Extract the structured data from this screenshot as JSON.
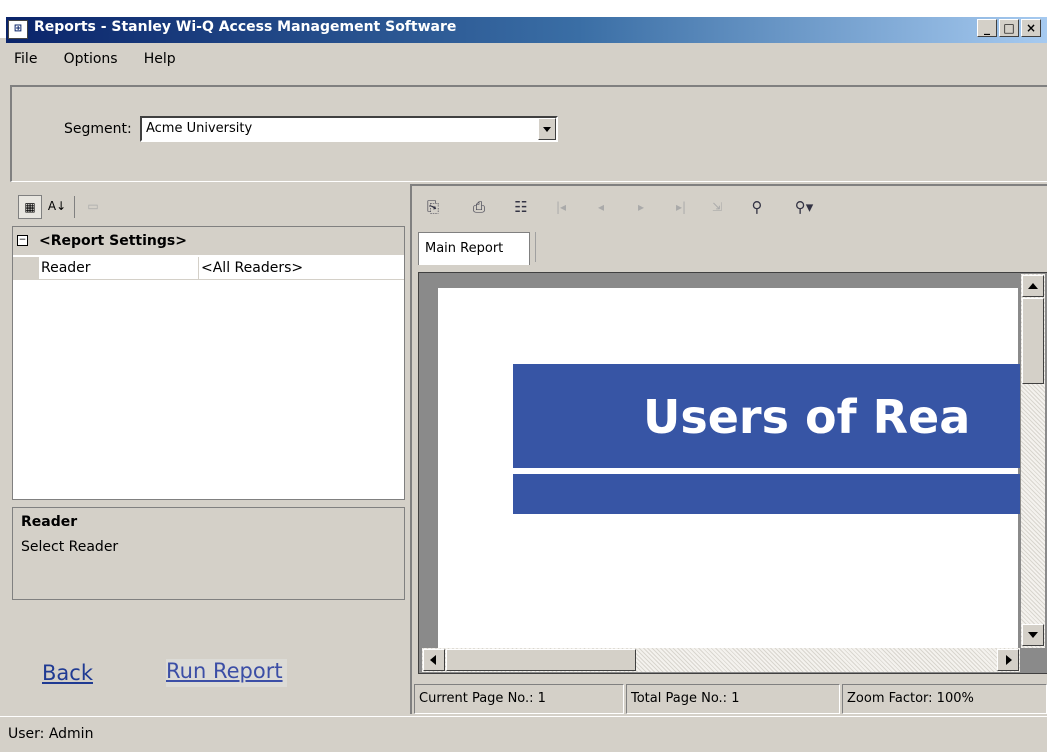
{
  "window": {
    "title": "Reports - Stanley Wi-Q Access Management Software",
    "app_icon": "app-icon",
    "minimize_label": "_",
    "maximize_label": "□",
    "close_label": "×"
  },
  "menu": {
    "file": "File",
    "options": "Options",
    "help": "Help"
  },
  "segment": {
    "label": "Segment:",
    "value": "Acme University"
  },
  "property_grid": {
    "toolbar_icons": [
      "categorized-icon",
      "alphabetical-sort-icon",
      "property-pages-icon"
    ],
    "category": "<Report Settings>",
    "rows": [
      {
        "name": "Reader",
        "value": "<All Readers>"
      }
    ],
    "help_title": "Reader",
    "help_description": "Select Reader"
  },
  "links": {
    "back": "Back",
    "run_report": "Run Report"
  },
  "viewer": {
    "toolbar_icons": [
      "export-icon",
      "print-icon",
      "group-tree-icon",
      "first-page-icon",
      "previous-page-icon",
      "next-page-icon",
      "last-page-icon",
      "go-to-page-icon",
      "search-icon",
      "zoom-icon"
    ],
    "tab": "Main Report",
    "report_title": "Users of Rea",
    "status": {
      "current_page": "Current Page No.: 1",
      "total_page": "Total Page No.: 1",
      "zoom": "Zoom Factor: 100%"
    }
  },
  "statusbar": {
    "user": "User: Admin"
  },
  "colors": {
    "banner": "#3755a5",
    "titlebar_start": "#0a246a",
    "link": "#1f3a93"
  }
}
